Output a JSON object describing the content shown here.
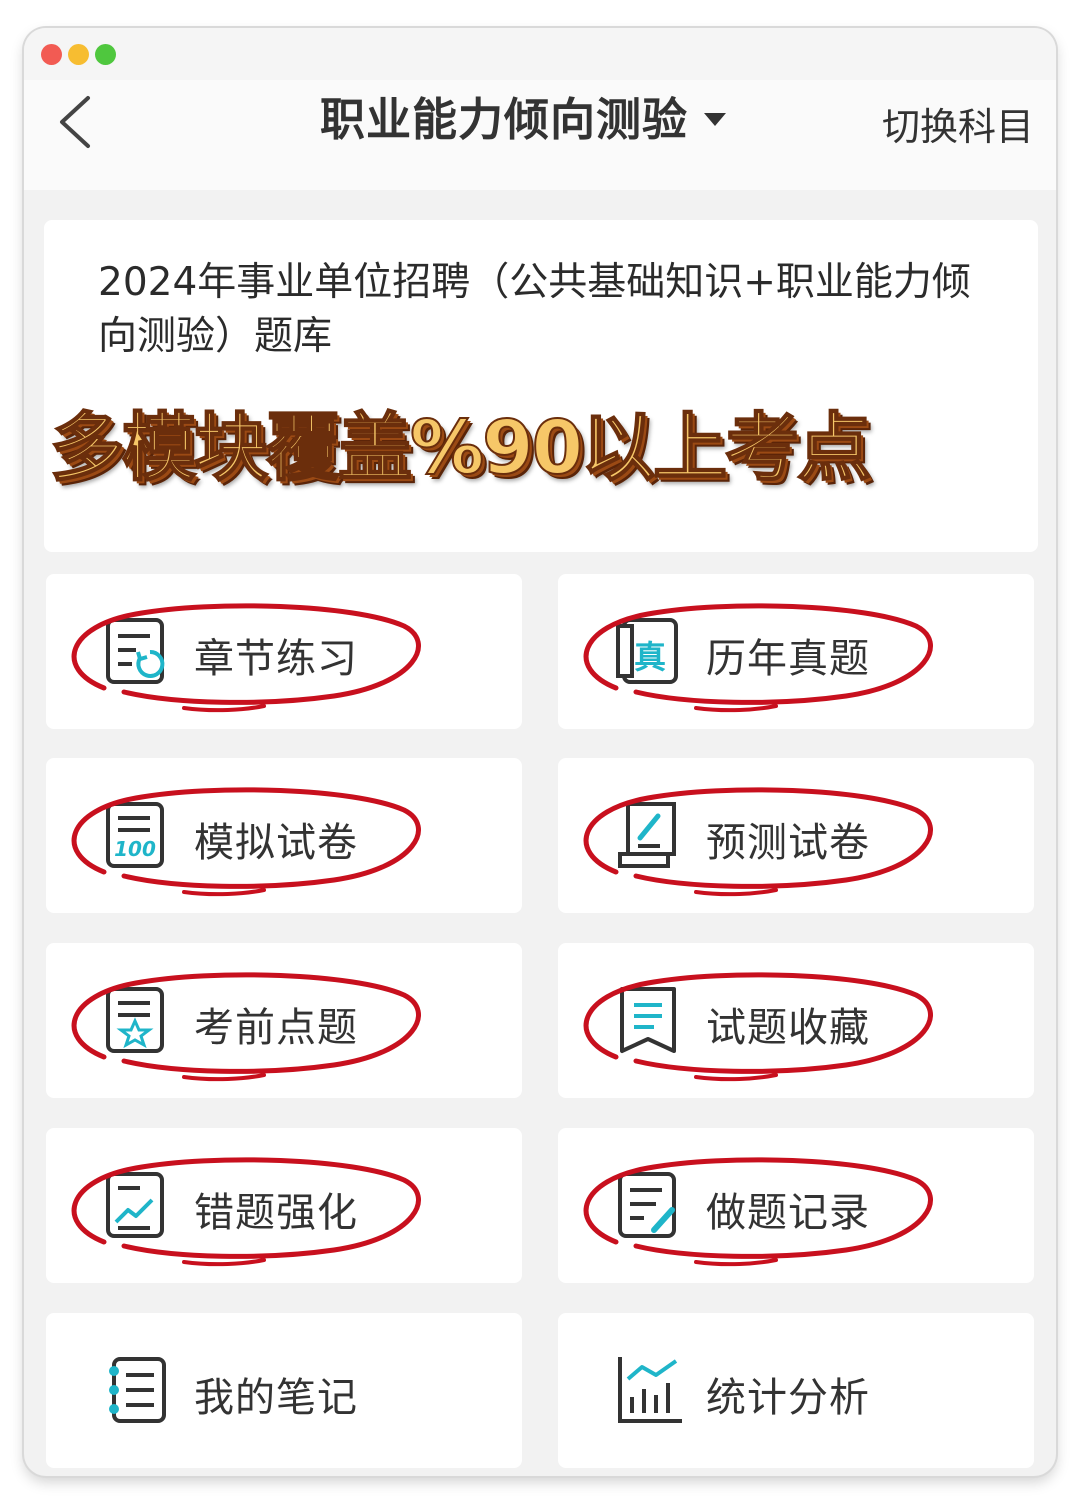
{
  "nav": {
    "title": "职业能力倾向测验",
    "switch_label": "切换科目"
  },
  "banner": {
    "title": "2024年事业单位招聘（公共基础知识+职业能力倾向测验）题库",
    "promo": "多模块覆盖%90以上考点"
  },
  "menu": [
    {
      "label": "章节练习",
      "icon": "chapter-practice-icon",
      "circled": true
    },
    {
      "label": "历年真题",
      "icon": "past-exams-icon",
      "circled": true
    },
    {
      "label": "模拟试卷",
      "icon": "mock-exam-icon",
      "circled": true
    },
    {
      "label": "预测试卷",
      "icon": "prediction-exam-icon",
      "circled": true
    },
    {
      "label": "考前点题",
      "icon": "pre-exam-tips-icon",
      "circled": true
    },
    {
      "label": "试题收藏",
      "icon": "favorites-icon",
      "circled": true
    },
    {
      "label": "错题强化",
      "icon": "wrong-questions-icon",
      "circled": true
    },
    {
      "label": "做题记录",
      "icon": "practice-record-icon",
      "circled": true
    },
    {
      "label": "我的笔记",
      "icon": "notes-icon",
      "circled": false
    },
    {
      "label": "统计分析",
      "icon": "statistics-icon",
      "circled": false
    }
  ],
  "colors": {
    "accent_teal": "#1fb5c9",
    "annotation_red": "#c8101e",
    "promo_gold": "#f6c768"
  }
}
